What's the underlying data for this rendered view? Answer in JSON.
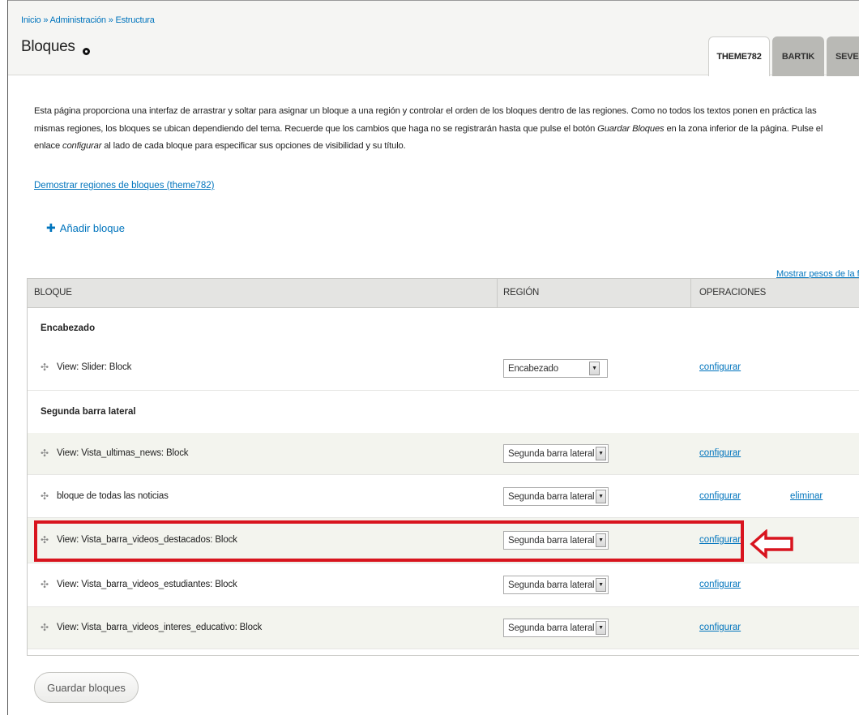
{
  "breadcrumb": {
    "items": [
      "Inicio",
      "Administración",
      "Estructura"
    ],
    "separator": "»"
  },
  "page_title": "Bloques",
  "tabs": [
    {
      "label": "THEME782",
      "active": true
    },
    {
      "label": "BARTIK",
      "active": false
    },
    {
      "label": "SEVEN",
      "active": false
    }
  ],
  "description": {
    "part1": "Esta página proporciona una interfaz de arrastrar y soltar para asignar un bloque a una región y controlar el orden de los bloques dentro de las regiones. Como no todos los textos ponen en práctica las mismas regiones, los bloques se ubican dependiendo del tema. Recuerde que los cambios que haga no se registrarán hasta que pulse el botón ",
    "em1": "Guardar Bloques",
    "part2": " en la zona inferior de la página. Pulse el enlace ",
    "em2": "configurar",
    "part3": " al lado de cada bloque para especificar sus opciones de visibilidad y su título."
  },
  "demo_link": "Demostrar regiones de bloques (theme782)",
  "add_block": {
    "icon": "plus-icon",
    "label": "Añadir bloque"
  },
  "show_weights": "Mostrar pesos de la fila",
  "table": {
    "headers": [
      "BLOQUE",
      "REGIÓN",
      "OPERACIONES"
    ],
    "regions": [
      {
        "title": "Encabezado",
        "blocks": [
          {
            "name": "View: Slider: Block",
            "region": "Encabezado",
            "configure": "configurar",
            "delete": ""
          }
        ]
      },
      {
        "title": "Segunda barra lateral",
        "blocks": [
          {
            "name": "View: Vista_ultimas_news: Block",
            "region": "Segunda barra lateral",
            "configure": "configurar",
            "delete": ""
          },
          {
            "name": "bloque de todas las noticias",
            "region": "Segunda barra lateral",
            "configure": "configurar",
            "delete": "eliminar"
          },
          {
            "name": "View: Vista_barra_videos_destacados: Block",
            "region": "Segunda barra lateral",
            "configure": "configurar",
            "delete": ""
          },
          {
            "name": "View: Vista_barra_videos_estudiantes: Block",
            "region": "Segunda barra lateral",
            "configure": "configurar",
            "delete": ""
          },
          {
            "name": "View: Vista_barra_videos_interes_educativo: Block",
            "region": "Segunda barra lateral",
            "configure": "configurar",
            "delete": ""
          }
        ]
      }
    ]
  },
  "annotation": {
    "highlight_color": "#d8141e",
    "arrow_icon": "left-arrow-outline-icon"
  },
  "save_button": "Guardar bloques",
  "colors": {
    "link": "#0074bd",
    "header_bg": "#f5f5f3",
    "even_row": "#f3f4ee"
  }
}
